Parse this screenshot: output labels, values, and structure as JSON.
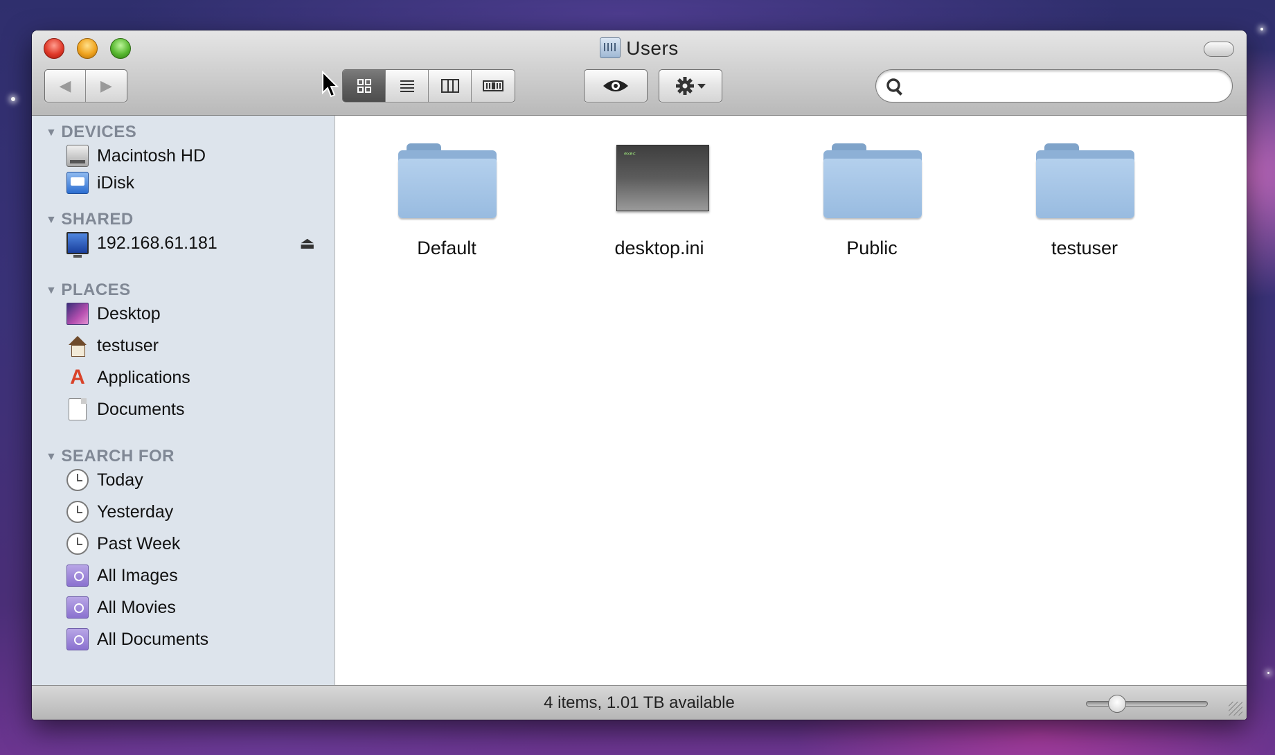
{
  "window": {
    "title": "Users",
    "status": "4 items, 1.01 TB available"
  },
  "toolbar": {
    "back_icon": "◀",
    "forward_icon": "▶",
    "view_icons": [
      "icon-view",
      "list-view",
      "column-view",
      "cover-flow-view"
    ],
    "active_view": "icon-view",
    "search": {
      "value": "",
      "placeholder": ""
    }
  },
  "sidebar": {
    "sections": [
      {
        "title": "DEVICES",
        "items": [
          "Macintosh HD",
          "iDisk"
        ]
      },
      {
        "title": "SHARED",
        "items": [
          "192.168.61.181"
        ]
      },
      {
        "title": "PLACES",
        "items": [
          "Desktop",
          "testuser",
          "Applications",
          "Documents"
        ]
      },
      {
        "title": "SEARCH FOR",
        "items": [
          "Today",
          "Yesterday",
          "Past Week",
          "All Images",
          "All Movies",
          "All Documents"
        ]
      }
    ]
  },
  "files": [
    {
      "name": "Default",
      "kind": "folder"
    },
    {
      "name": "desktop.ini",
      "kind": "executable"
    },
    {
      "name": "Public",
      "kind": "folder"
    },
    {
      "name": "testuser",
      "kind": "folder"
    }
  ],
  "colors": {
    "sidebar_bg": "#dde4ec",
    "section_header": "#808895",
    "folder": "#98bbe0"
  }
}
